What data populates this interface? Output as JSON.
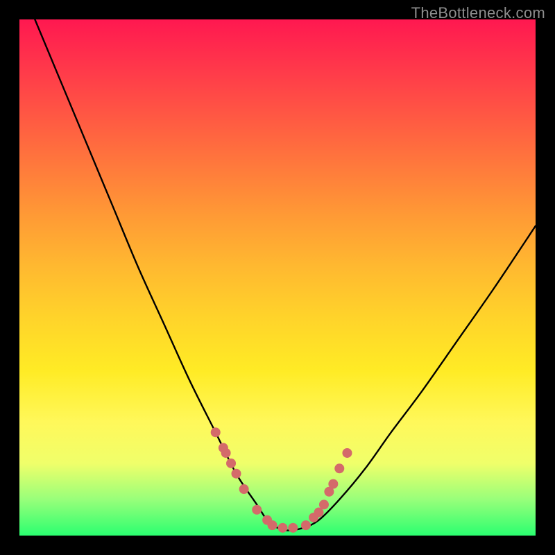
{
  "watermark": "TheBottleneck.com",
  "colors": {
    "black": "#000000",
    "dot": "#d46a6a",
    "gradient_top": "#ff1850",
    "gradient_bottom": "#2bff70"
  },
  "chart_data": {
    "type": "line",
    "title": "",
    "xlabel": "",
    "ylabel": "",
    "xlim": [
      0,
      100
    ],
    "ylim": [
      0,
      100
    ],
    "grid": false,
    "legend": false,
    "series": [
      {
        "name": "bottleneck-curve",
        "x": [
          3,
          8,
          13,
          18,
          23,
          28,
          33,
          38,
          42,
          46,
          48,
          50,
          52,
          55,
          58,
          62,
          67,
          72,
          78,
          85,
          92,
          100
        ],
        "y": [
          100,
          88,
          76,
          64,
          52,
          41,
          30,
          20,
          12,
          6,
          3,
          1.5,
          1,
          1.5,
          3,
          7,
          13,
          20,
          28,
          38,
          48,
          60
        ]
      }
    ],
    "annotations": {
      "scatter_dots": {
        "name": "highlighted-points",
        "x": [
          38,
          39.5,
          40,
          41,
          42,
          43.5,
          46,
          48,
          49,
          51,
          53,
          55.5,
          57,
          58,
          59,
          60,
          60.8,
          62,
          63.5
        ],
        "y": [
          20,
          17,
          16,
          14,
          12,
          9,
          5,
          3,
          2,
          1.5,
          1.5,
          2,
          3.5,
          4.5,
          6,
          8.5,
          10,
          13,
          16
        ]
      }
    }
  }
}
